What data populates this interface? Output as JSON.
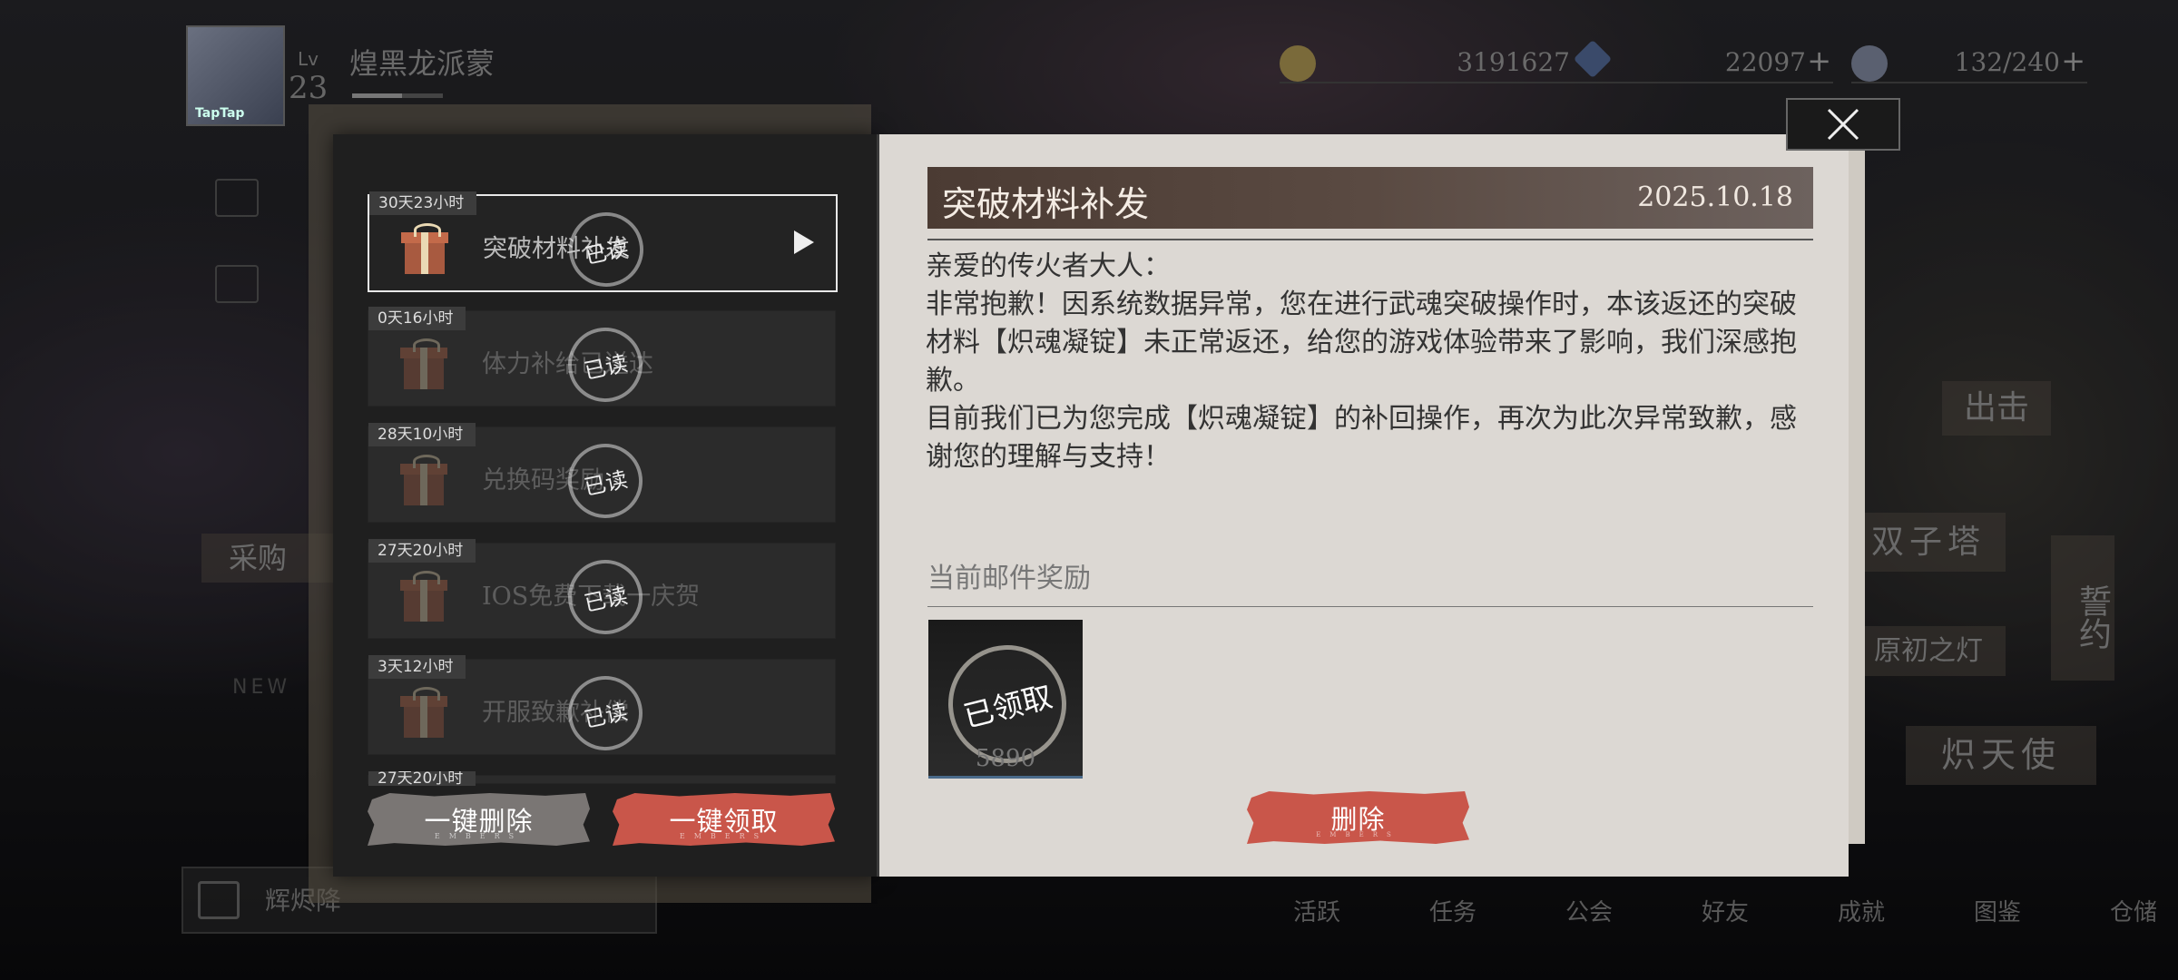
{
  "player": {
    "lv_label": "Lv",
    "level": "23",
    "name": "煌黑龙派蒙",
    "avatar_badge": "TapTap",
    "xp_fraction": 0.55
  },
  "resources": [
    {
      "icon": "gold-coin-icon",
      "value": "3191627",
      "plus": false
    },
    {
      "icon": "crystal-icon",
      "value": "22097",
      "plus": true
    },
    {
      "icon": "stamina-potion-icon",
      "value": "132/240",
      "plus": true
    }
  ],
  "side_menu": {
    "shop_label": "采购",
    "new_label": "NEW"
  },
  "chat": {
    "text": "辉烬降"
  },
  "right_banners": {
    "depart": "出击",
    "twin_tower": "双子塔",
    "oath": "誓约",
    "origin_lamp": "原初之灯",
    "angel": "炽天使"
  },
  "bottom_nav": [
    "活跃",
    "任务",
    "公会",
    "好友",
    "成就",
    "图鉴",
    "仓储"
  ],
  "mail_list": [
    {
      "timer": "30天23小时",
      "title": "突破材料补发",
      "read_label": "已读",
      "selected": true
    },
    {
      "timer": "0天16小时",
      "title": "体力补给已送达",
      "read_label": "已读",
      "selected": false
    },
    {
      "timer": "28天10小时",
      "title": "兑换码奖励",
      "read_label": "已读",
      "selected": false
    },
    {
      "timer": "27天20小时",
      "title": "IOS免费下载一庆贺",
      "read_label": "已读",
      "selected": false
    },
    {
      "timer": "3天12小时",
      "title": "开服致歉补偿",
      "read_label": "已读",
      "selected": false
    },
    {
      "timer": "27天20小时",
      "title": "",
      "read_label": "",
      "selected": false
    }
  ],
  "buttons": {
    "delete_all": "一键删除",
    "claim_all": "一键领取",
    "delete": "删除",
    "sub_caption": "EMBERS"
  },
  "mail": {
    "title": "突破材料补发",
    "date": "2025.10.18",
    "greeting": "亲爱的传火者大人：",
    "paragraph1": "非常抱歉！因系统数据异常，您在进行武魂突破操作时，本该返还的突破材料【炽魂凝锭】未正常返还，给您的游戏体验带来了影响，我们深感抱歉。",
    "paragraph2": "目前我们已为您完成【炽魂凝锭】的补回操作，再次为此次异常致歉，感谢您的理解与支持！",
    "reward_label": "当前邮件奖励",
    "reward": {
      "stamp": "已领取",
      "quantity": "5890"
    }
  },
  "colors": {
    "accent_red": "#c9564a",
    "title_bar": "#4b3b33",
    "panel_bg": "#dcd8d3"
  }
}
